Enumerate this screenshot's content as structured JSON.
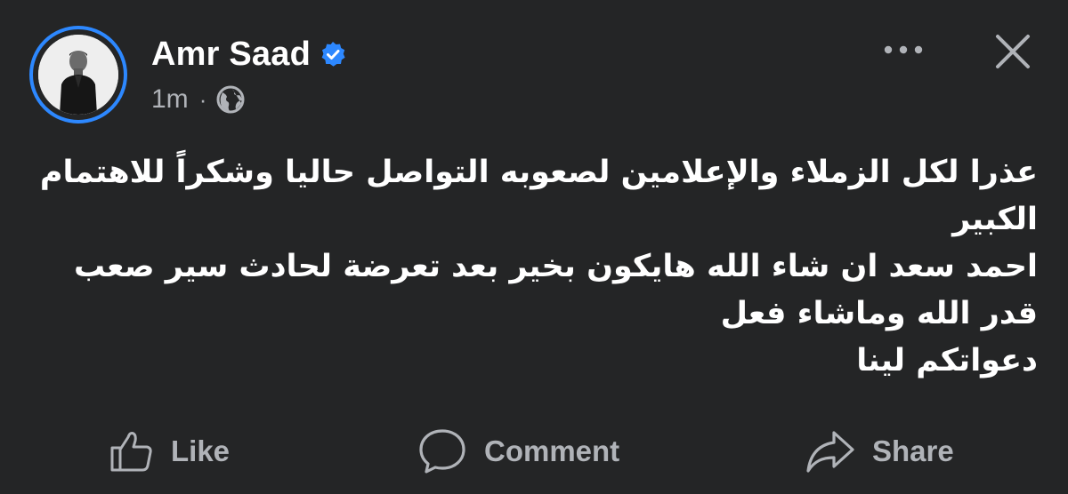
{
  "post": {
    "author": {
      "name": "Amr Saad",
      "verified": true,
      "avatar_icon": "profile-photo"
    },
    "timestamp": "1m",
    "separator": "·",
    "audience_icon": "globe-icon",
    "menu_icon": "more-icon",
    "close_icon": "close-icon",
    "text_lines": [
      "عذرا لكل الزملاء والإعلامين لصعوبه التواصل حاليا  وشكراً للاهتمام",
      "الكبير",
      "احمد سعد ان شاء الله هايكون بخير بعد تعرضة لحادث سير صعب",
      "قدر الله وماشاء فعل",
      "دعواتكم لينا"
    ]
  },
  "actions": {
    "like_label": "Like",
    "comment_label": "Comment",
    "share_label": "Share"
  },
  "colors": {
    "background": "#242526",
    "text_primary": "#ffffff",
    "text_secondary": "#b0b3b8",
    "accent": "#2d88ff"
  }
}
